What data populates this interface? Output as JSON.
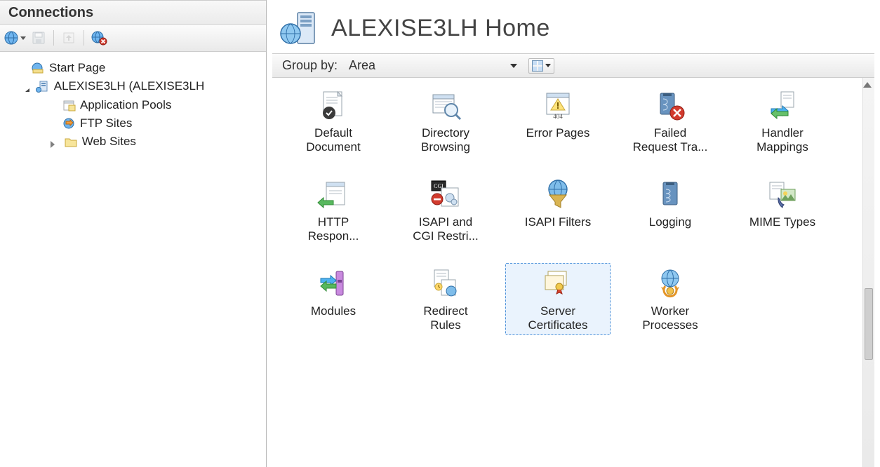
{
  "sidebar": {
    "title": "Connections",
    "toolbar": {
      "connect_label": "Connect",
      "save_label": "Save",
      "up_label": "Up",
      "delete_label": "Delete"
    },
    "tree": {
      "start_page": "Start Page",
      "server_name": "ALEXISE3LH (ALEXISE3LH",
      "app_pools": "Application Pools",
      "ftp_sites": "FTP Sites",
      "web_sites": "Web Sites"
    }
  },
  "header": {
    "title": "ALEXISE3LH Home"
  },
  "groupbar": {
    "label": "Group by:",
    "selected": "Area"
  },
  "features": [
    {
      "id": "default-document",
      "line1": "Default",
      "line2": "Document",
      "selected": false
    },
    {
      "id": "directory-browsing",
      "line1": "Directory",
      "line2": "Browsing",
      "selected": false
    },
    {
      "id": "error-pages",
      "line1": "Error Pages",
      "line2": "",
      "selected": false
    },
    {
      "id": "failed-request",
      "line1": "Failed",
      "line2": "Request Tra...",
      "selected": false
    },
    {
      "id": "handler-mappings",
      "line1": "Handler",
      "line2": "Mappings",
      "selected": false
    },
    {
      "id": "http-response",
      "line1": "HTTP",
      "line2": "Respon...",
      "selected": false
    },
    {
      "id": "isapi-cgi",
      "line1": "ISAPI and",
      "line2": "CGI Restri...",
      "selected": false
    },
    {
      "id": "isapi-filters",
      "line1": "ISAPI Filters",
      "line2": "",
      "selected": false
    },
    {
      "id": "logging",
      "line1": "Logging",
      "line2": "",
      "selected": false
    },
    {
      "id": "mime-types",
      "line1": "MIME Types",
      "line2": "",
      "selected": false
    },
    {
      "id": "modules",
      "line1": "Modules",
      "line2": "",
      "selected": false
    },
    {
      "id": "redirect-rules",
      "line1": "Redirect",
      "line2": "Rules",
      "selected": false
    },
    {
      "id": "server-certs",
      "line1": "Server",
      "line2": "Certificates",
      "selected": true
    },
    {
      "id": "worker-processes",
      "line1": "Worker",
      "line2": "Processes",
      "selected": false
    }
  ],
  "error_badge_text": "404"
}
